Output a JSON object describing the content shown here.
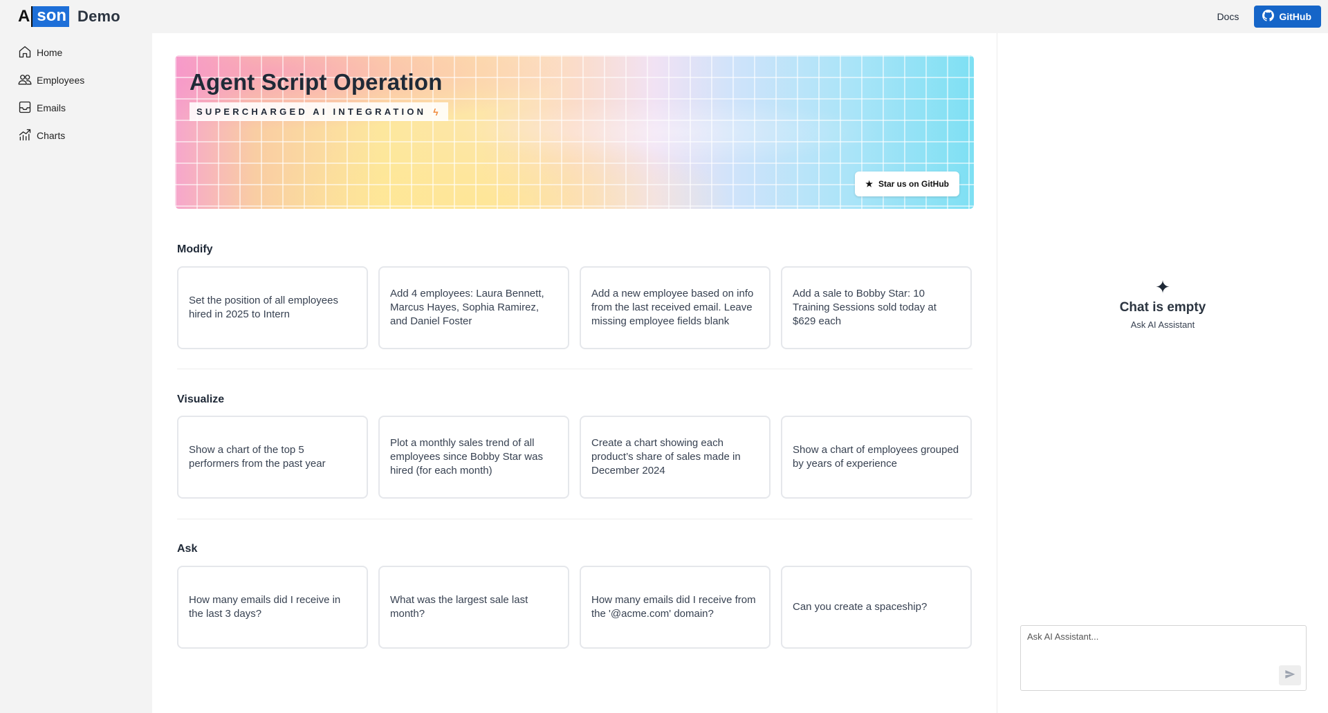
{
  "header": {
    "logo_a": "A",
    "logo_son": "son",
    "app_name": "Demo",
    "docs_label": "Docs",
    "github_label": "GitHub"
  },
  "sidebar": {
    "items": [
      {
        "label": "Home",
        "icon": "home-icon"
      },
      {
        "label": "Employees",
        "icon": "users-icon"
      },
      {
        "label": "Emails",
        "icon": "inbox-icon"
      },
      {
        "label": "Charts",
        "icon": "chart-icon"
      }
    ]
  },
  "hero": {
    "title": "Agent Script Operation",
    "tagline": "SUPERCHARGED AI INTEGRATION",
    "star_label": "Star us on GitHub"
  },
  "sections": {
    "modify": {
      "title": "Modify",
      "cards": [
        "Set the position of all employees hired in 2025 to Intern",
        "Add 4 employees: Laura Bennett, Marcus Hayes, Sophia Ramirez, and Daniel Foster",
        "Add a new employee based on info from the last received email. Leave missing employee fields blank",
        "Add a sale to Bobby Star: 10 Training Sessions sold today at $629 each"
      ]
    },
    "visualize": {
      "title": "Visualize",
      "cards": [
        "Show a chart of the top 5 performers from the past year",
        "Plot a monthly sales trend of all employees since Bobby Star was hired (for each month)",
        "Create a chart showing each product’s share of sales made in December 2024",
        "Show a chart of employees grouped by years of experience"
      ]
    },
    "ask": {
      "title": "Ask",
      "cards": [
        "How many emails did I receive in the last 3 days?",
        "What was the largest sale last month?",
        "How many emails did I receive from the '@acme.com' domain?",
        "Can you create a spaceship?"
      ]
    }
  },
  "chat": {
    "empty_title": "Chat is empty",
    "empty_subtitle": "Ask AI Assistant",
    "input_placeholder": "Ask AI Assistant...",
    "input_value": ""
  },
  "colors": {
    "accent": "#1565c8",
    "logo_blue": "#1d6fd8"
  }
}
